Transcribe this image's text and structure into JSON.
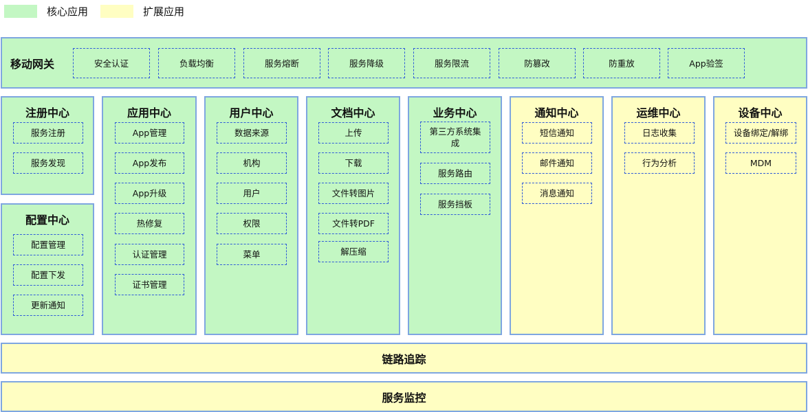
{
  "legend": {
    "core": {
      "label": "核心应用",
      "color": "#c3f7c3"
    },
    "extended": {
      "label": "扩展应用",
      "color": "#fffec2"
    }
  },
  "gateway": {
    "title": "移动网关",
    "items": [
      "安全认证",
      "负载均衡",
      "服务熔断",
      "服务降级",
      "服务限流",
      "防篡改",
      "防重放",
      "App验签"
    ]
  },
  "columns": {
    "registry": {
      "title": "注册中心",
      "items": [
        "服务注册",
        "服务发现"
      ]
    },
    "config": {
      "title": "配置中心",
      "items": [
        "配置管理",
        "配置下发",
        "更新通知"
      ]
    },
    "app": {
      "title": "应用中心",
      "items": [
        "App管理",
        "App发布",
        "App升级",
        "热修复",
        "认证管理",
        "证书管理"
      ]
    },
    "user": {
      "title": "用户中心",
      "items": [
        "数据来源",
        "机构",
        "用户",
        "权限",
        "菜单"
      ]
    },
    "doc": {
      "title": "文档中心",
      "items": [
        "上传",
        "下载",
        "文件转图片",
        "文件转PDF",
        "解压缩"
      ]
    },
    "business": {
      "title": "业务中心",
      "items": [
        "第三方系统集成",
        "服务路由",
        "服务挡板"
      ]
    },
    "notify": {
      "title": "通知中心",
      "items": [
        "短信通知",
        "邮件通知",
        "消息通知"
      ]
    },
    "ops": {
      "title": "运维中心",
      "items": [
        "日志收集",
        "行为分析"
      ]
    },
    "device": {
      "title": "设备中心",
      "items": [
        "设备绑定/解绑",
        "MDM"
      ]
    }
  },
  "tracing": {
    "title": "链路追踪"
  },
  "monitoring": {
    "title": "服务监控"
  }
}
